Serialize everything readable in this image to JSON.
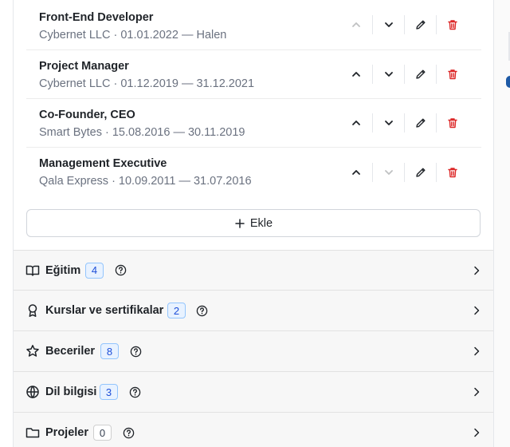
{
  "experience": {
    "items": [
      {
        "title": "Front-End Developer",
        "subtitle": "Cybernet LLC · 01.01.2022 — Halen"
      },
      {
        "title": "Project Manager",
        "subtitle": "Cybernet LLC · 01.12.2019 — 31.12.2021"
      },
      {
        "title": "Co-Founder, CEO",
        "subtitle": "Smart Bytes · 15.08.2016 — 30.11.2019"
      },
      {
        "title": "Management Executive",
        "subtitle": "Qala Express · 10.09.2011 — 31.07.2016"
      }
    ],
    "add_label": "Ekle"
  },
  "sections": [
    {
      "label": "Eğitim",
      "count": "4",
      "icon": "book-icon"
    },
    {
      "label": "Kurslar ve sertifikalar",
      "count": "2",
      "icon": "award-icon"
    },
    {
      "label": "Beceriler",
      "count": "8",
      "icon": "star-icon"
    },
    {
      "label": "Dil bilgisi",
      "count": "3",
      "icon": "globe-icon"
    },
    {
      "label": "Projeler",
      "count": "0",
      "icon": "folder-icon"
    }
  ],
  "colors": {
    "delete": "#dc2626",
    "badge_border": "#93c5fd",
    "badge_text": "#1d4ed8"
  }
}
